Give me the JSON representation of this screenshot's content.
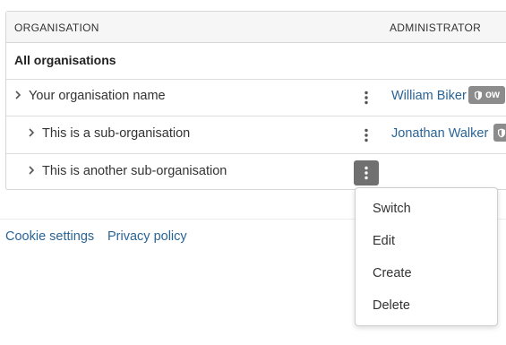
{
  "table": {
    "headers": {
      "organisation": "ORGANISATION",
      "administrator": "ADMINISTRATOR"
    },
    "all_label": "All organisations",
    "rows": [
      {
        "name": "Your organisation name",
        "admin": "William Biker",
        "badge": "ow"
      },
      {
        "name": "This is a sub-organisation",
        "admin": "Jonathan Walker",
        "badge": ""
      },
      {
        "name": "This is another sub-organisation",
        "admin": "",
        "badge": ""
      }
    ]
  },
  "footer": {
    "cookie_settings": "Cookie settings",
    "privacy_policy": "Privacy policy"
  },
  "menu": {
    "items": [
      "Switch",
      "Edit",
      "Create",
      "Delete"
    ]
  },
  "icons": {
    "expand": "chevron-right-icon",
    "actions": "vertical-ellipsis-icon",
    "badge": "shield-icon"
  },
  "colors": {
    "link": "#2a6496",
    "badge_bg": "#8c8c8c",
    "active_kebab_bg": "#707070",
    "header_bg": "#f6f6f6"
  }
}
